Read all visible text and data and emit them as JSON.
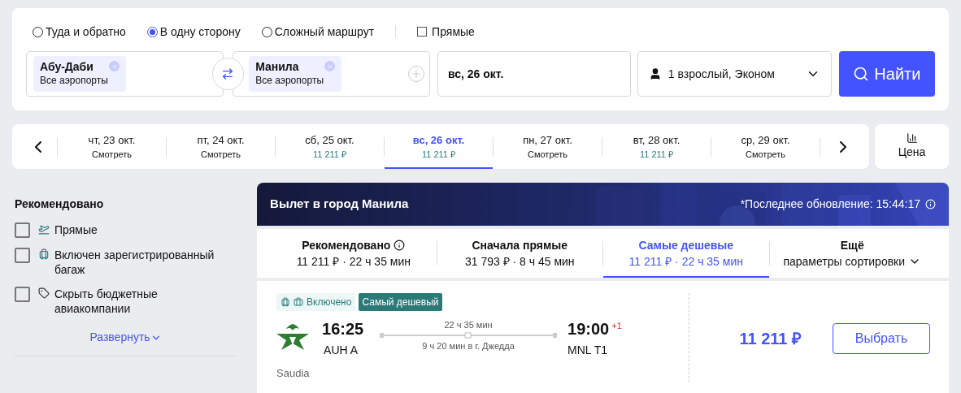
{
  "trip_types": [
    {
      "label": "Туда и обратно",
      "selected": false
    },
    {
      "label": "В одну сторону",
      "selected": true
    },
    {
      "label": "Сложный маршрут",
      "selected": false
    }
  ],
  "direct_only": {
    "label": "Прямые",
    "checked": false
  },
  "origin": {
    "city": "Абу-Даби",
    "airports": "Все аэропорты"
  },
  "destination": {
    "city": "Манила",
    "airports": "Все аэропорты"
  },
  "date": "вс, 26 окт.",
  "passengers": "1 взрослый, Эконом",
  "search_button": "Найти",
  "dates": [
    {
      "date": "чт, 23 окт.",
      "price": "Смотреть",
      "kind": "view",
      "selected": false
    },
    {
      "date": "пт, 24 окт.",
      "price": "Смотреть",
      "kind": "view",
      "selected": false
    },
    {
      "date": "сб, 25 окт.",
      "price": "11 211 ₽",
      "kind": "price",
      "selected": false
    },
    {
      "date": "вс, 26 окт.",
      "price": "11 211 ₽",
      "kind": "price",
      "selected": true
    },
    {
      "date": "пн, 27 окт.",
      "price": "Смотреть",
      "kind": "view",
      "selected": false
    },
    {
      "date": "вт, 28 окт.",
      "price": "11 211 ₽",
      "kind": "price",
      "selected": false
    },
    {
      "date": "ср, 29 окт.",
      "price": "Смотреть",
      "kind": "view",
      "selected": false
    }
  ],
  "price_chart_button": "Цена",
  "filters": {
    "title": "Рекомендовано",
    "items": [
      {
        "label": "Прямые",
        "kind": "direct",
        "checked": false
      },
      {
        "label": "Включен зарегистрированный багаж",
        "kind": "baggage",
        "checked": false
      },
      {
        "label": "Скрыть бюджетные авиакомпании",
        "kind": "budget",
        "checked": false
      }
    ],
    "expand_link": "Развернуть"
  },
  "banner": {
    "title": "Вылет в город Манила",
    "updated": "*Последнее обновление: 15:44:17"
  },
  "sort_tabs": [
    {
      "title": "Рекомендовано",
      "subtitle": "11 211 ₽ · 22 ч 35 мин",
      "kind": "info",
      "selected": false
    },
    {
      "title": "Сначала прямые",
      "subtitle": "31 793 ₽ · 8 ч 45 мин",
      "kind": "plain",
      "selected": false
    },
    {
      "title": "Самые дешевые",
      "subtitle": "11 211 ₽ · 22 ч 35 мин",
      "kind": "plain",
      "selected": true
    },
    {
      "title": "Ещё",
      "subtitle": "параметры сортировки",
      "kind": "menu",
      "selected": false
    }
  ],
  "flight": {
    "baggage": "Включено",
    "badge": "Самый дешевый",
    "depart_time": "16:25",
    "depart_airport": "AUH A",
    "duration": "22 ч 35 мин",
    "stopover": "9 ч 20 мин в г. Джедда",
    "arrive_time": "19:00",
    "day_offset": "+1",
    "arrive_airport": "MNL T1",
    "airline": "Saudia",
    "price": "11 211 ₽",
    "select_button": "Выбрать"
  }
}
